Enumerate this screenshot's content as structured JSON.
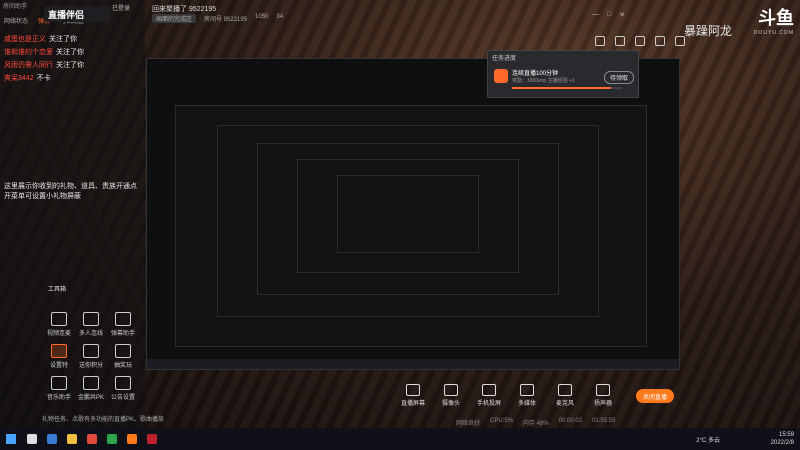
{
  "app": {
    "logo_text": "直播伴侣",
    "logo_sub": "已登录",
    "topbar_text": "房间助手"
  },
  "left": {
    "tabs": [
      "网络状态",
      "弹幕",
      "可调配置"
    ],
    "chat": [
      {
        "user": "咸蛋也是正义",
        "msg": "关注了你"
      },
      {
        "user": "谁和谁的个恋爱",
        "msg": "关注了你"
      },
      {
        "user": "风雨仍需人同行",
        "msg": "关注了你"
      },
      {
        "user": "爽呆3442",
        "msg": "不卡"
      }
    ],
    "hint": "这里展示你收到的礼物、道具、贵族开通点开菜单可设置小礼物屏蔽"
  },
  "tools": {
    "title": "工具箱",
    "items": [
      {
        "label": "视频连麦",
        "orange": false
      },
      {
        "label": "多人连线",
        "orange": false
      },
      {
        "label": "弹幕助手",
        "orange": false
      },
      {
        "label": "设置特",
        "orange": true
      },
      {
        "label": "送你积分",
        "orange": false
      },
      {
        "label": "抽奖玩",
        "orange": false
      },
      {
        "label": "音乐助手",
        "orange": false
      },
      {
        "label": "金鹏共PK",
        "orange": false
      },
      {
        "label": "公告设置",
        "orange": false
      }
    ]
  },
  "bottom_hint": "礼物任务、点歌有多功能的直播PK、歌曲播放",
  "stream": {
    "title": "回来聚播了 9522195",
    "meta": [
      "画面的完成区",
      "房间号 9522195",
      "1050",
      "34"
    ]
  },
  "popup": {
    "title": "任务进度",
    "name": "连续直播100分钟",
    "desc": "奖励：1000exp  主播经验 +1",
    "button": "待领取",
    "progress": 0.9
  },
  "livebar": [
    "直播屏幕",
    "摄像头",
    "手机投屏",
    "多媒体",
    "麦克风",
    "扬声器"
  ],
  "start_button": "关闭直播",
  "status": [
    "网络良好",
    "CPU:5%",
    "内存 48%",
    "00:00:02",
    "01:55:55"
  ],
  "overlay_name": "暴躁阿龙",
  "douyu": {
    "text": "斗鱼",
    "sub": "DOUYU.COM"
  },
  "taskbar": {
    "temp": "2°C 多云",
    "time": "15:59",
    "date": "2022/2/8"
  },
  "colors": {
    "accent": "#ff6a2b",
    "chat_user": "#ff4a3a"
  }
}
